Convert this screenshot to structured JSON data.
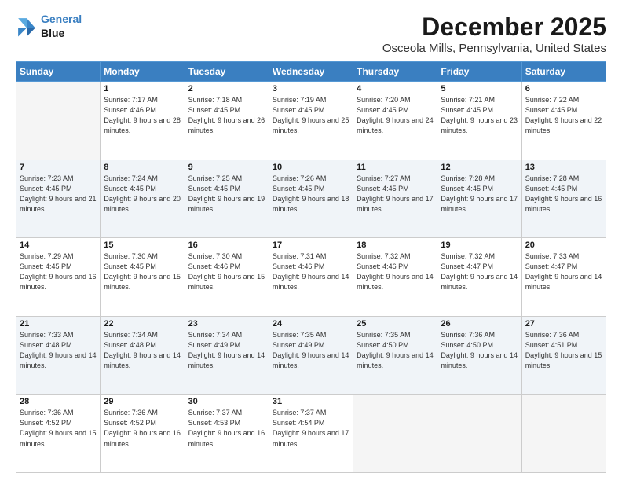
{
  "logo": {
    "line1": "General",
    "line2": "Blue"
  },
  "title": "December 2025",
  "subtitle": "Osceola Mills, Pennsylvania, United States",
  "weekdays": [
    "Sunday",
    "Monday",
    "Tuesday",
    "Wednesday",
    "Thursday",
    "Friday",
    "Saturday"
  ],
  "weeks": [
    [
      {
        "day": "",
        "sunrise": "",
        "sunset": "",
        "daylight": ""
      },
      {
        "day": "1",
        "sunrise": "Sunrise: 7:17 AM",
        "sunset": "Sunset: 4:46 PM",
        "daylight": "Daylight: 9 hours and 28 minutes."
      },
      {
        "day": "2",
        "sunrise": "Sunrise: 7:18 AM",
        "sunset": "Sunset: 4:45 PM",
        "daylight": "Daylight: 9 hours and 26 minutes."
      },
      {
        "day": "3",
        "sunrise": "Sunrise: 7:19 AM",
        "sunset": "Sunset: 4:45 PM",
        "daylight": "Daylight: 9 hours and 25 minutes."
      },
      {
        "day": "4",
        "sunrise": "Sunrise: 7:20 AM",
        "sunset": "Sunset: 4:45 PM",
        "daylight": "Daylight: 9 hours and 24 minutes."
      },
      {
        "day": "5",
        "sunrise": "Sunrise: 7:21 AM",
        "sunset": "Sunset: 4:45 PM",
        "daylight": "Daylight: 9 hours and 23 minutes."
      },
      {
        "day": "6",
        "sunrise": "Sunrise: 7:22 AM",
        "sunset": "Sunset: 4:45 PM",
        "daylight": "Daylight: 9 hours and 22 minutes."
      }
    ],
    [
      {
        "day": "7",
        "sunrise": "Sunrise: 7:23 AM",
        "sunset": "Sunset: 4:45 PM",
        "daylight": "Daylight: 9 hours and 21 minutes."
      },
      {
        "day": "8",
        "sunrise": "Sunrise: 7:24 AM",
        "sunset": "Sunset: 4:45 PM",
        "daylight": "Daylight: 9 hours and 20 minutes."
      },
      {
        "day": "9",
        "sunrise": "Sunrise: 7:25 AM",
        "sunset": "Sunset: 4:45 PM",
        "daylight": "Daylight: 9 hours and 19 minutes."
      },
      {
        "day": "10",
        "sunrise": "Sunrise: 7:26 AM",
        "sunset": "Sunset: 4:45 PM",
        "daylight": "Daylight: 9 hours and 18 minutes."
      },
      {
        "day": "11",
        "sunrise": "Sunrise: 7:27 AM",
        "sunset": "Sunset: 4:45 PM",
        "daylight": "Daylight: 9 hours and 17 minutes."
      },
      {
        "day": "12",
        "sunrise": "Sunrise: 7:28 AM",
        "sunset": "Sunset: 4:45 PM",
        "daylight": "Daylight: 9 hours and 17 minutes."
      },
      {
        "day": "13",
        "sunrise": "Sunrise: 7:28 AM",
        "sunset": "Sunset: 4:45 PM",
        "daylight": "Daylight: 9 hours and 16 minutes."
      }
    ],
    [
      {
        "day": "14",
        "sunrise": "Sunrise: 7:29 AM",
        "sunset": "Sunset: 4:45 PM",
        "daylight": "Daylight: 9 hours and 16 minutes."
      },
      {
        "day": "15",
        "sunrise": "Sunrise: 7:30 AM",
        "sunset": "Sunset: 4:45 PM",
        "daylight": "Daylight: 9 hours and 15 minutes."
      },
      {
        "day": "16",
        "sunrise": "Sunrise: 7:30 AM",
        "sunset": "Sunset: 4:46 PM",
        "daylight": "Daylight: 9 hours and 15 minutes."
      },
      {
        "day": "17",
        "sunrise": "Sunrise: 7:31 AM",
        "sunset": "Sunset: 4:46 PM",
        "daylight": "Daylight: 9 hours and 14 minutes."
      },
      {
        "day": "18",
        "sunrise": "Sunrise: 7:32 AM",
        "sunset": "Sunset: 4:46 PM",
        "daylight": "Daylight: 9 hours and 14 minutes."
      },
      {
        "day": "19",
        "sunrise": "Sunrise: 7:32 AM",
        "sunset": "Sunset: 4:47 PM",
        "daylight": "Daylight: 9 hours and 14 minutes."
      },
      {
        "day": "20",
        "sunrise": "Sunrise: 7:33 AM",
        "sunset": "Sunset: 4:47 PM",
        "daylight": "Daylight: 9 hours and 14 minutes."
      }
    ],
    [
      {
        "day": "21",
        "sunrise": "Sunrise: 7:33 AM",
        "sunset": "Sunset: 4:48 PM",
        "daylight": "Daylight: 9 hours and 14 minutes."
      },
      {
        "day": "22",
        "sunrise": "Sunrise: 7:34 AM",
        "sunset": "Sunset: 4:48 PM",
        "daylight": "Daylight: 9 hours and 14 minutes."
      },
      {
        "day": "23",
        "sunrise": "Sunrise: 7:34 AM",
        "sunset": "Sunset: 4:49 PM",
        "daylight": "Daylight: 9 hours and 14 minutes."
      },
      {
        "day": "24",
        "sunrise": "Sunrise: 7:35 AM",
        "sunset": "Sunset: 4:49 PM",
        "daylight": "Daylight: 9 hours and 14 minutes."
      },
      {
        "day": "25",
        "sunrise": "Sunrise: 7:35 AM",
        "sunset": "Sunset: 4:50 PM",
        "daylight": "Daylight: 9 hours and 14 minutes."
      },
      {
        "day": "26",
        "sunrise": "Sunrise: 7:36 AM",
        "sunset": "Sunset: 4:50 PM",
        "daylight": "Daylight: 9 hours and 14 minutes."
      },
      {
        "day": "27",
        "sunrise": "Sunrise: 7:36 AM",
        "sunset": "Sunset: 4:51 PM",
        "daylight": "Daylight: 9 hours and 15 minutes."
      }
    ],
    [
      {
        "day": "28",
        "sunrise": "Sunrise: 7:36 AM",
        "sunset": "Sunset: 4:52 PM",
        "daylight": "Daylight: 9 hours and 15 minutes."
      },
      {
        "day": "29",
        "sunrise": "Sunrise: 7:36 AM",
        "sunset": "Sunset: 4:52 PM",
        "daylight": "Daylight: 9 hours and 16 minutes."
      },
      {
        "day": "30",
        "sunrise": "Sunrise: 7:37 AM",
        "sunset": "Sunset: 4:53 PM",
        "daylight": "Daylight: 9 hours and 16 minutes."
      },
      {
        "day": "31",
        "sunrise": "Sunrise: 7:37 AM",
        "sunset": "Sunset: 4:54 PM",
        "daylight": "Daylight: 9 hours and 17 minutes."
      },
      {
        "day": "",
        "sunrise": "",
        "sunset": "",
        "daylight": ""
      },
      {
        "day": "",
        "sunrise": "",
        "sunset": "",
        "daylight": ""
      },
      {
        "day": "",
        "sunrise": "",
        "sunset": "",
        "daylight": ""
      }
    ]
  ]
}
